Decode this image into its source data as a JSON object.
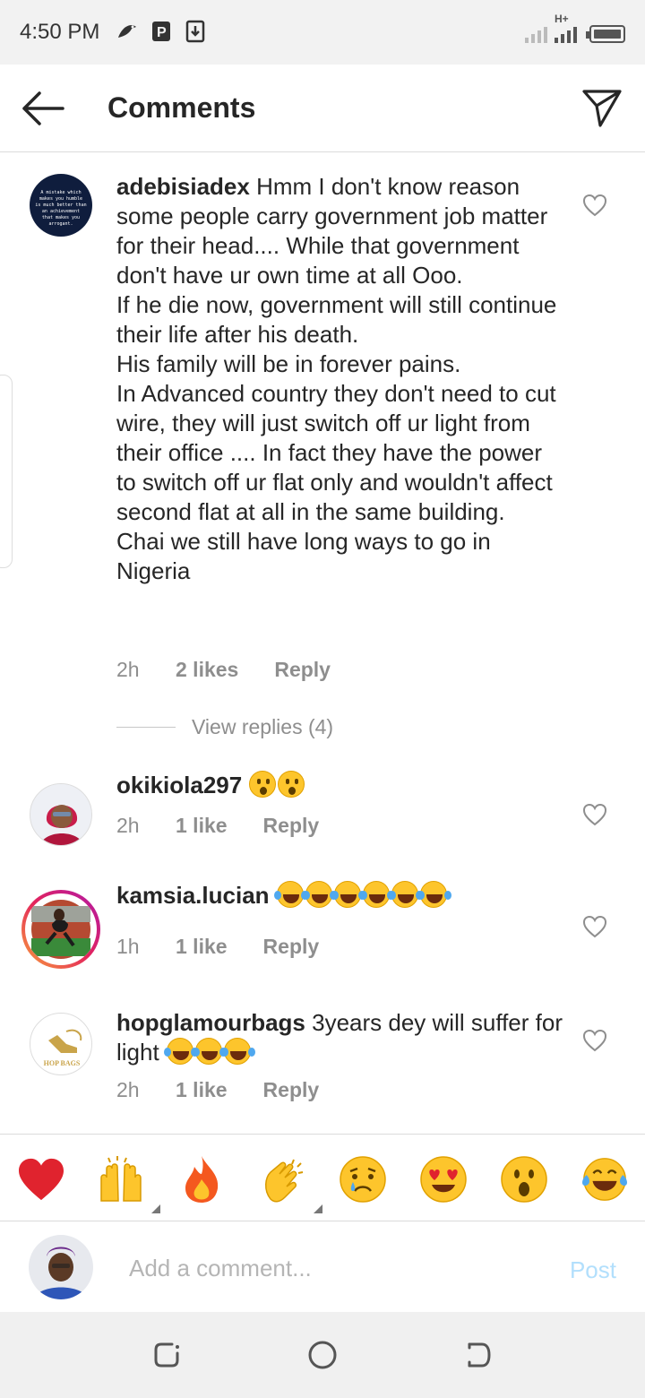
{
  "status_bar": {
    "time": "4:50 PM",
    "network_label": "H+",
    "icons": [
      "bird-icon",
      "p-icon",
      "download-icon",
      "signal-icon",
      "battery-icon"
    ]
  },
  "header": {
    "title": "Comments",
    "back_icon": "arrow-left-icon",
    "send_icon": "paper-plane-icon"
  },
  "comments": [
    {
      "username": "adebisiadex",
      "text": " Hmm I don't know reason some people carry government job matter for their head.... While that government don't have ur own time at all Ooo.\nIf he die now, government will still continue their life after his death.\nHis family will be in forever pains.\nIn Advanced country they don't need to cut wire, they will just switch off ur light from their office .... In fact they have the power to switch off ur flat only and wouldn't affect second flat at all in the same building.\nChai we still have long ways to go in Nigeria",
      "time": "2h",
      "likes": "2 likes",
      "reply": "Reply",
      "avatar_quote": "A mistake which makes you humble is much better than an achievement that makes you arrogant.",
      "view_replies": "View replies (4)"
    },
    {
      "username": "okikiola297",
      "text": "",
      "emojis": [
        "astonished-face",
        "astonished-face"
      ],
      "time": "2h",
      "likes": "1 like",
      "reply": "Reply"
    },
    {
      "username": "kamsia.lucian",
      "text": "",
      "emojis": [
        "tears-of-joy-face",
        "tears-of-joy-face",
        "tears-of-joy-face",
        "tears-of-joy-face",
        "tears-of-joy-face",
        "tears-of-joy-face"
      ],
      "time": "1h",
      "likes": "1 like",
      "reply": "Reply"
    },
    {
      "username": "hopglamourbags",
      "text": " 3years dey will suffer for light ",
      "emojis": [
        "tears-of-joy-face",
        "tears-of-joy-face",
        "tears-of-joy-face"
      ],
      "time": "2h",
      "likes": "1 like",
      "reply": "Reply",
      "avatar_logo": "HOP BAGS"
    }
  ],
  "emoji_bar": [
    "red-heart",
    "raising-hands",
    "fire",
    "clapping-hands",
    "crying-face",
    "heart-eyes-face",
    "astonished-face",
    "tears-of-joy-face"
  ],
  "input": {
    "placeholder": "Add a comment...",
    "post_label": "Post"
  },
  "colors": {
    "post_disabled": "#b2dffc",
    "secondary_text": "#8e8e8e",
    "story_ring": "#e3245c"
  }
}
